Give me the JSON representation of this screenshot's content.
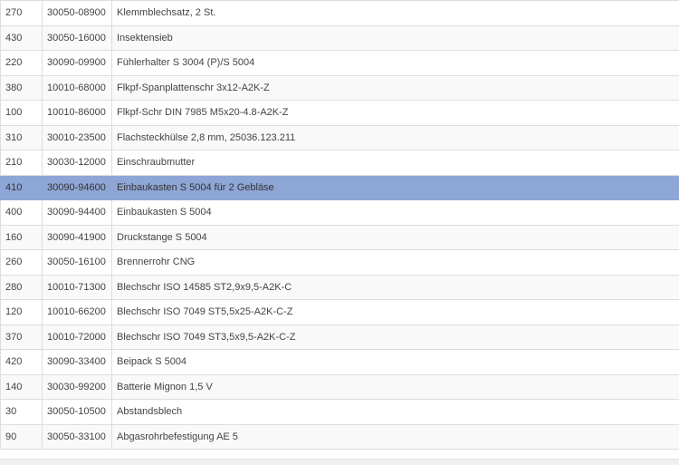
{
  "colors": {
    "selected_row": "#8ea6d6",
    "border": "#dddddd",
    "text": "#444444"
  },
  "parts": [
    {
      "pos": "270",
      "article": "30050-08900",
      "description": "Klemmblechsatz, 2 St."
    },
    {
      "pos": "430",
      "article": "30050-16000",
      "description": "Insektensieb"
    },
    {
      "pos": "220",
      "article": "30090-09900",
      "description": "Fühlerhalter S 3004 (P)/S 5004"
    },
    {
      "pos": "380",
      "article": "10010-68000",
      "description": "Flkpf-Spanplattenschr 3x12-A2K-Z"
    },
    {
      "pos": "100",
      "article": "10010-86000",
      "description": "Flkpf-Schr DIN 7985 M5x20-4.8-A2K-Z"
    },
    {
      "pos": "310",
      "article": "30010-23500",
      "description": "Flachsteckhülse 2,8 mm, 25036.123.211"
    },
    {
      "pos": "210",
      "article": "30030-12000",
      "description": "Einschraubmutter"
    },
    {
      "pos": "410",
      "article": "30090-94600",
      "description": "Einbaukasten S 5004 für 2 Gebläse",
      "selected": true
    },
    {
      "pos": "400",
      "article": "30090-94400",
      "description": "Einbaukasten S 5004"
    },
    {
      "pos": "160",
      "article": "30090-41900",
      "description": "Druckstange S 5004"
    },
    {
      "pos": "260",
      "article": "30050-16100",
      "description": "Brennerrohr CNG"
    },
    {
      "pos": "280",
      "article": "10010-71300",
      "description": "Blechschr ISO 14585 ST2,9x9,5-A2K-C"
    },
    {
      "pos": "120",
      "article": "10010-66200",
      "description": "Blechschr ISO 7049 ST5,5x25-A2K-C-Z"
    },
    {
      "pos": "370",
      "article": "10010-72000",
      "description": "Blechschr ISO 7049 ST3,5x9,5-A2K-C-Z"
    },
    {
      "pos": "420",
      "article": "30090-33400",
      "description": "Beipack S 5004"
    },
    {
      "pos": "140",
      "article": "30030-99200",
      "description": "Batterie Mignon 1,5 V"
    },
    {
      "pos": "30",
      "article": "30050-10500",
      "description": "Abstandsblech"
    },
    {
      "pos": "90",
      "article": "30050-33100",
      "description": "Abgasrohrbefestigung AE 5"
    }
  ]
}
